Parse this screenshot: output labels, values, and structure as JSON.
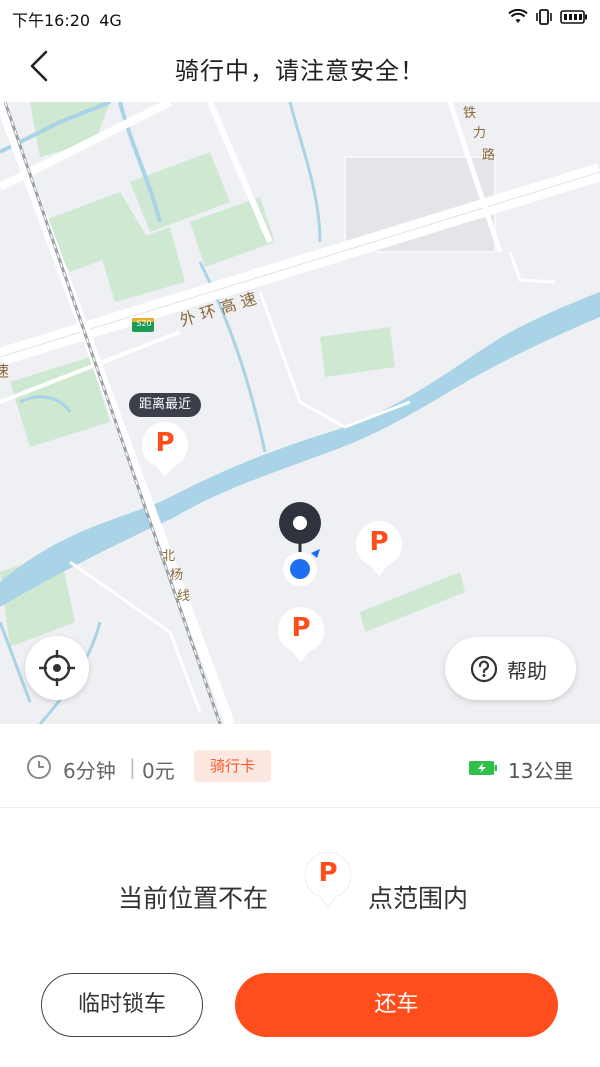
{
  "status_bar": {
    "time": "下午16:20",
    "network": "4G"
  },
  "header": {
    "title": "骑行中，请注意安全！"
  },
  "map": {
    "nearest_tag": "距离最近",
    "parking_letter": "P",
    "road_labels": {
      "highway": "外 环 高 速",
      "highway_short": "速",
      "highway_shield": "S20",
      "tieli_road": [
        "铁",
        "力",
        "路"
      ],
      "beiyang_line": [
        "北",
        "杨",
        "线"
      ]
    },
    "colors": {
      "water": "#a9d3e6",
      "green": "#cfe8d2",
      "road": "#ffffff",
      "rail": "#9aa0a6",
      "pin_orange": "#ff4e1c",
      "user_blue": "#1e6ff0"
    }
  },
  "controls": {
    "help_label": "帮助"
  },
  "ride": {
    "duration": "6分钟",
    "separator": "|",
    "cost": "0元",
    "card_label": "骑行卡",
    "range": "13公里"
  },
  "notice": {
    "before": "当前位置不在",
    "after": "点范围内"
  },
  "actions": {
    "temp_lock": "临时锁车",
    "return_bike": "还车"
  }
}
